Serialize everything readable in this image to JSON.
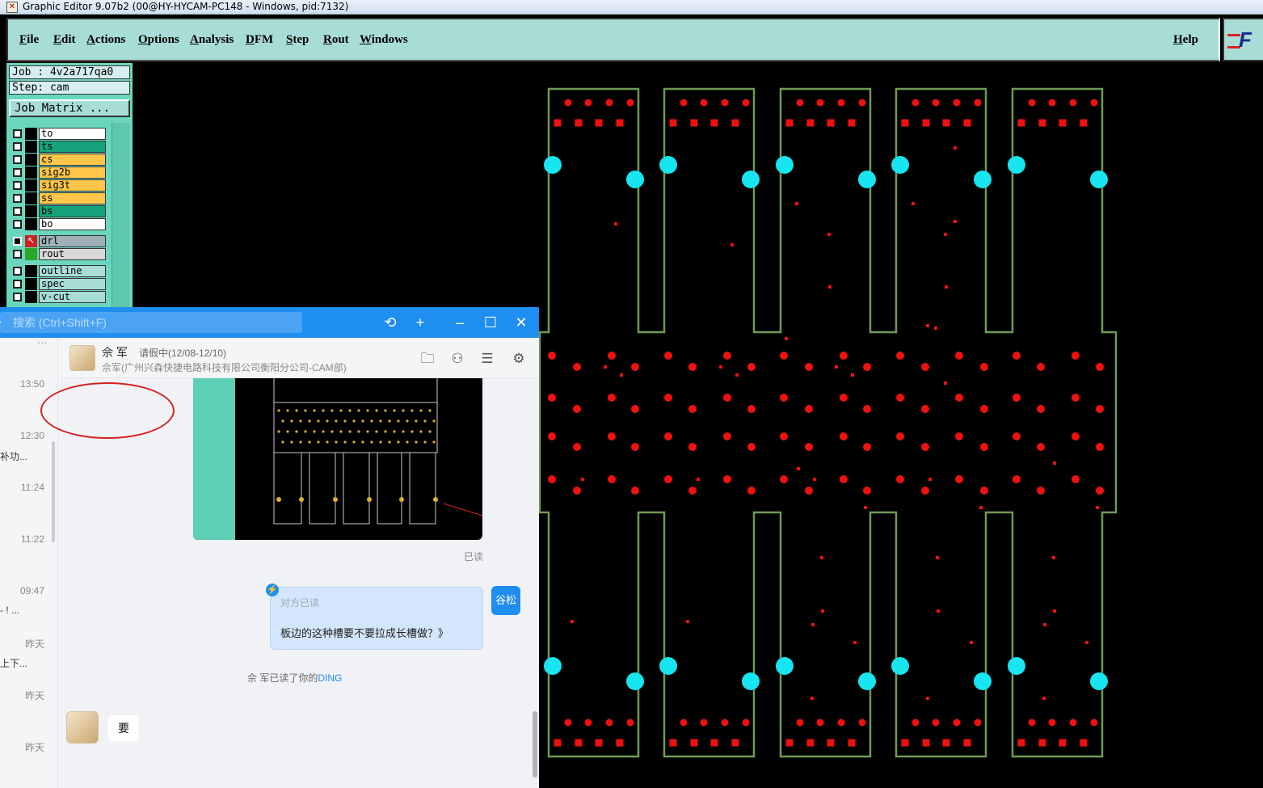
{
  "window": {
    "title": "Graphic Editor 9.07b2 (00@HY-HYCAM-PC148 - Windows, pid:7132)"
  },
  "menu": {
    "items": [
      "File",
      "Edit",
      "Actions",
      "Options",
      "Analysis",
      "DFM",
      "Step",
      "Rout",
      "Windows"
    ],
    "help": "Help",
    "logo": "F"
  },
  "panel": {
    "job": "Job : 4v2a717qa0",
    "step": "Step: cam",
    "job_matrix": "Job Matrix ...",
    "layers": [
      {
        "name": "to",
        "color": "#ffffff"
      },
      {
        "name": "ts",
        "color": "#14a37a"
      },
      {
        "name": "cs",
        "color": "#ffc64a"
      },
      {
        "name": "sig2b",
        "color": "#ffc64a"
      },
      {
        "name": "sig3t",
        "color": "#ffc64a"
      },
      {
        "name": "ss",
        "color": "#ffc64a"
      },
      {
        "name": "bs",
        "color": "#14a37a"
      },
      {
        "name": "bo",
        "color": "#ffffff"
      },
      {
        "name": "drl",
        "color": "#9fb0b8",
        "active": true
      },
      {
        "name": "rout",
        "color": "#d8d8d8"
      },
      {
        "name": "outline",
        "color": "#a8dcd6"
      },
      {
        "name": "spec",
        "color": "#a8dcd6"
      },
      {
        "name": "v-cut",
        "color": "#a8dcd6"
      }
    ]
  },
  "chat": {
    "search_placeholder": "搜索 (Ctrl+Shift+F)",
    "conversations": [
      {
        "time": "13:50",
        "snippet": ""
      },
      {
        "time": "12:30",
        "snippet": "补功..."
      },
      {
        "time": "11:24",
        "snippet": ""
      },
      {
        "time": "11:22",
        "snippet": ""
      },
      {
        "time": "09:47",
        "snippet": "- ! ..."
      },
      {
        "time": "昨天",
        "snippet": "上下..."
      },
      {
        "time": "昨天",
        "snippet": ""
      },
      {
        "time": "昨天",
        "snippet": ""
      }
    ],
    "more": "···",
    "contact": {
      "name": "佘 军",
      "status": "请假中(12/08-12/10)",
      "org": "佘军(广州兴森快捷电路科技有限公司衡阳分公司-CAM部)"
    },
    "read_label": "已读",
    "ding": {
      "read_label": "对方已读",
      "text": "板边的这种槽要不要拉成长槽做？》",
      "sender_avatar": "谷松"
    },
    "ding_notice": {
      "prefix": "佘 军已读了你的",
      "link": "DING"
    },
    "reply": "要"
  },
  "colors": {
    "outline": "#6f9a55",
    "pad": "#ee1111",
    "tooling": "#17e5f0",
    "accent": "#1e8ef0"
  }
}
